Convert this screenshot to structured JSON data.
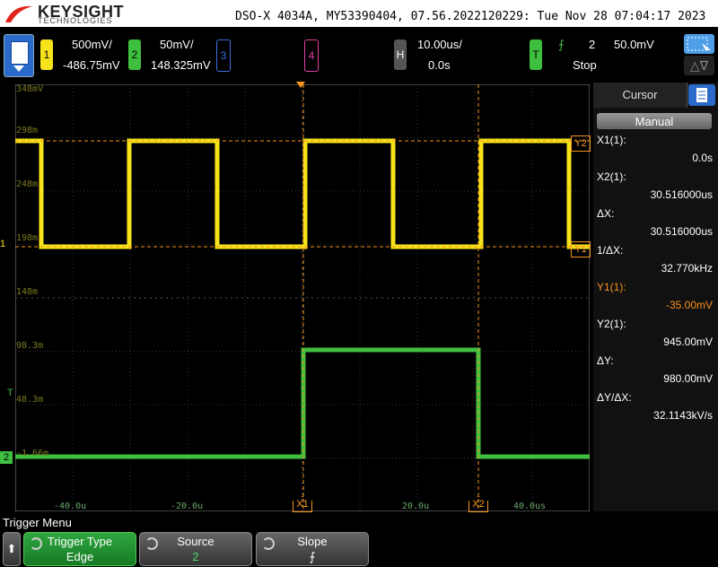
{
  "header": {
    "logo_main": "KEYSIGHT",
    "logo_sub": "TECHNOLOGIES",
    "title": "DSO-X 4034A, MY53390404, 07.56.2022120229: Tue Nov 28 07:04:17 2023"
  },
  "channels": [
    {
      "num": "1",
      "scale": "500mV/",
      "offset": "-486.75mV",
      "color": "#f7e31b"
    },
    {
      "num": "2",
      "scale": "50mV/",
      "offset": "148.325mV",
      "color": "#3fbf3f"
    },
    {
      "num": "3",
      "color": "#3f6fdf"
    },
    {
      "num": "4",
      "color": "#e040a0"
    }
  ],
  "timebase": {
    "label": "H",
    "scale": "10.00us/",
    "delay": "0.0s"
  },
  "trigger": {
    "label": "T",
    "edge_symbol": "⨍",
    "source": "2",
    "level": "50.0mV",
    "state": "Stop"
  },
  "scale_labels": {
    "y": [
      "348mV",
      "298m",
      "248m",
      "198m",
      "148m",
      "98.3m",
      "48.3m",
      "-1.66m"
    ],
    "x": [
      "-40.0u",
      "-20.0u",
      "20.0u",
      "40.0us"
    ]
  },
  "markers": {
    "x1": "X1",
    "x2": "X2",
    "y1": "Y1",
    "y2": "Y2",
    "ch1": "1",
    "ch2": "2",
    "trig": "T"
  },
  "cursor_panel": {
    "tab": "Cursor",
    "mode": "Manual",
    "rows": [
      {
        "label": "X1(1):",
        "value": "0.0s",
        "color": "#ffffff"
      },
      {
        "label": "X2(1):",
        "value": "30.516000us",
        "color": "#ffffff"
      },
      {
        "label": "ΔX:",
        "value": "30.516000us",
        "color": "#ffffff"
      },
      {
        "label": "1/ΔX:",
        "value": "32.770kHz",
        "color": "#ffffff"
      },
      {
        "label": "Y1(1):",
        "value": "-35.00mV",
        "color": "#f7931e"
      },
      {
        "label": "Y2(1):",
        "value": "945.00mV",
        "color": "#ffffff"
      },
      {
        "label": "ΔY:",
        "value": "980.00mV",
        "color": "#ffffff"
      },
      {
        "label": "ΔY/ΔX:",
        "value": "32.1143kV/s",
        "color": "#ffffff"
      }
    ]
  },
  "softkeys": {
    "menu_title": "Trigger Menu",
    "up_arrow": "⬆",
    "items": [
      {
        "label": "Trigger Type",
        "value": "Edge"
      },
      {
        "label": "Source",
        "value": "2"
      },
      {
        "label": "Slope",
        "value": "⨍"
      }
    ]
  }
}
